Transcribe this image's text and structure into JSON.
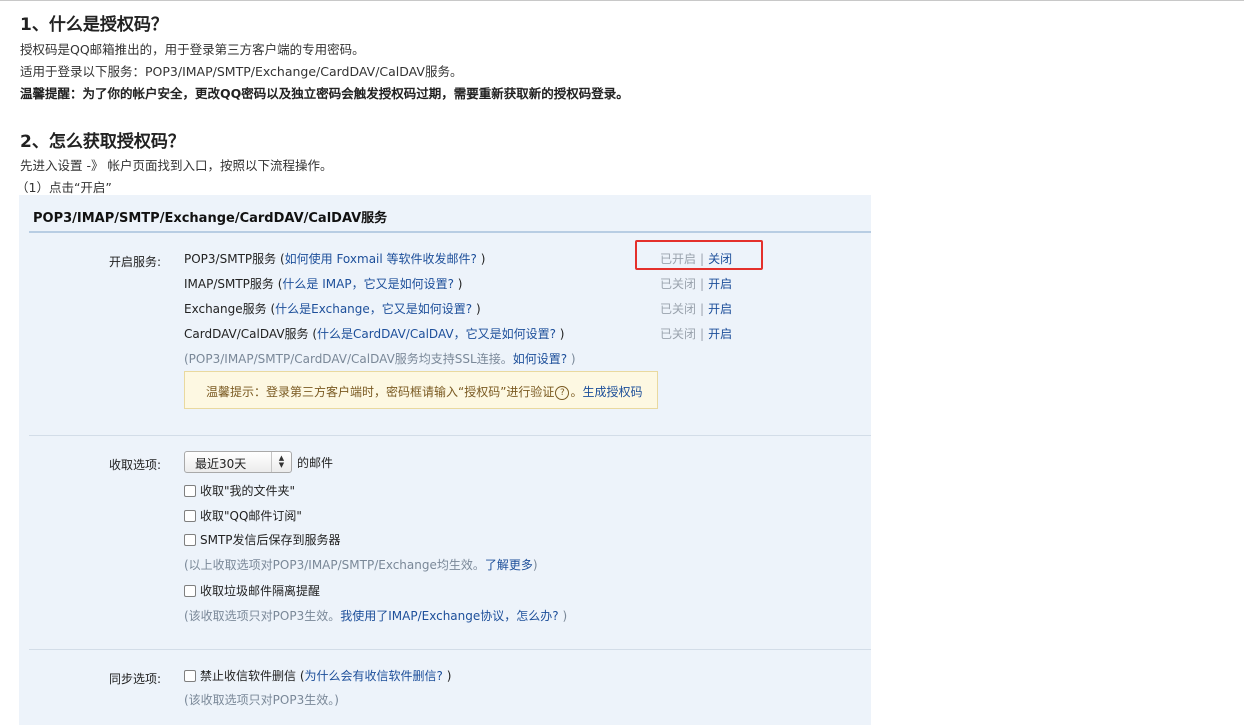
{
  "sections": {
    "s1_title": "1、什么是授权码？",
    "s1_line1": "授权码是QQ邮箱推出的，用于登录第三方客户端的专用密码。",
    "s1_line2": "适用于登录以下服务：POP3/IMAP/SMTP/Exchange/CardDAV/CalDAV服务。",
    "s1_warning": "温馨提醒：为了你的帐户安全，更改QQ密码以及独立密码会触发授权码过期，需要重新获取新的授权码登录。",
    "s2_title": "2、怎么获取授权码？",
    "s2_line1": "先进入设置 -》 帐户页面找到入口，按照以下流程操作。",
    "s2_step1": "（1）点击“开启”"
  },
  "panel": {
    "title": "POP3/IMAP/SMTP/Exchange/CardDAV/CalDAV服务",
    "services_label": "开启服务:",
    "services": [
      {
        "name": "POP3/SMTP服务",
        "open_paren": " (",
        "help_link": "如何使用 Foxmail 等软件收发邮件?",
        "close_paren": " )",
        "state": "已开启",
        "sep": "|",
        "action": "关闭"
      },
      {
        "name": "IMAP/SMTP服务",
        "open_paren": " (",
        "help_link": "什么是 IMAP，它又是如何设置?",
        "close_paren": " )",
        "state": "已关闭",
        "sep": "|",
        "action": "开启"
      },
      {
        "name": "Exchange服务",
        "open_paren": " (",
        "help_link": "什么是Exchange，它又是如何设置?",
        "close_paren": " )",
        "state": "已关闭",
        "sep": "|",
        "action": "开启"
      },
      {
        "name": "CardDAV/CalDAV服务",
        "open_paren": " (",
        "help_link": "什么是CardDAV/CalDAV，它又是如何设置?",
        "close_paren": " )",
        "state": "已关闭",
        "sep": "|",
        "action": "开启"
      }
    ],
    "ssl_note": "(POP3/IMAP/SMTP/CardDAV/CalDAV服务均支持SSL连接。",
    "ssl_link": "如何设置?",
    "ssl_close": " )",
    "tip_text": "温馨提示：登录第三方客户端时，密码框请输入“授权码”进行验证",
    "tip_q": "?",
    "tip_dot": "。",
    "tip_link": "生成授权码",
    "receive_label": "收取选项:",
    "receive_select": "最近30天",
    "receive_suffix": "的邮件",
    "receive_opt1": "收取\"我的文件夹\"",
    "receive_opt2": "收取\"QQ邮件订阅\"",
    "receive_opt3": "SMTP发信后保存到服务器",
    "receive_note": "(以上收取选项对POP3/IMAP/SMTP/Exchange均生效。",
    "receive_note_link": "了解更多",
    "receive_note_close": ")",
    "receive_opt4": "收取垃圾邮件隔离提醒",
    "receive_note2": "(该收取选项只对POP3生效。",
    "receive_note2_link": "我使用了IMAP/Exchange协议，怎么办?",
    "receive_note2_close": " )",
    "sync_label": "同步选项:",
    "sync_opt1": "禁止收信软件删信",
    "sync_opt1_open": " (",
    "sync_opt1_link": "为什么会有收信软件删信?",
    "sync_opt1_close": " )",
    "sync_note": "(该收取选项只对POP3生效。)"
  },
  "colors": {
    "link": "#1d4f9a",
    "highlight": "#e4302b",
    "panel_bg": "#edf3fa",
    "tip_bg": "#fdf8e2"
  }
}
